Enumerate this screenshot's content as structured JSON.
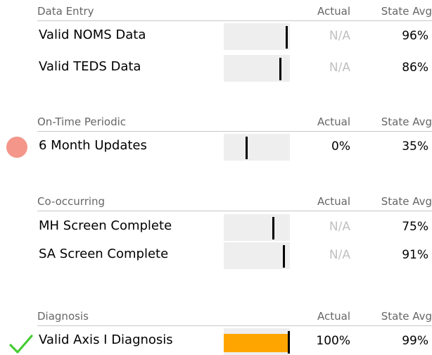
{
  "columns": {
    "actual": "Actual",
    "state_avg": "State Avg"
  },
  "colors": {
    "bar_bg": "#eeeeee",
    "fill": "#ffa500",
    "alert": "#f4968a",
    "check": "#44cc33",
    "na_text": "#c0c0c0"
  },
  "sections": [
    {
      "title": "Data Entry",
      "rows": [
        {
          "label": "Valid NOMS Data",
          "actual": "N/A",
          "actual_fill_pct": 0,
          "state_avg": "96%",
          "state_avg_pct": 96,
          "status": "none"
        },
        {
          "label": "Valid TEDS Data",
          "actual": "N/A",
          "actual_fill_pct": 0,
          "state_avg": "86%",
          "state_avg_pct": 86,
          "status": "none"
        }
      ]
    },
    {
      "title": "On-Time Periodic",
      "rows": [
        {
          "label": "6 Month Updates",
          "actual": "0%",
          "actual_fill_pct": 0,
          "state_avg": "35%",
          "state_avg_pct": 35,
          "status": "alert-icon"
        }
      ]
    },
    {
      "title": "Co-occurring",
      "rows": [
        {
          "label": "MH Screen Complete",
          "actual": "N/A",
          "actual_fill_pct": 0,
          "state_avg": "75%",
          "state_avg_pct": 75,
          "status": "none"
        },
        {
          "label": "SA Screen Complete",
          "actual": "N/A",
          "actual_fill_pct": 0,
          "state_avg": "91%",
          "state_avg_pct": 91,
          "status": "none"
        }
      ]
    },
    {
      "title": "Diagnosis",
      "rows": [
        {
          "label": "Valid Axis I Diagnosis",
          "actual": "100%",
          "actual_fill_pct": 100,
          "state_avg": "99%",
          "state_avg_pct": 99,
          "status": "check-icon"
        }
      ]
    }
  ]
}
